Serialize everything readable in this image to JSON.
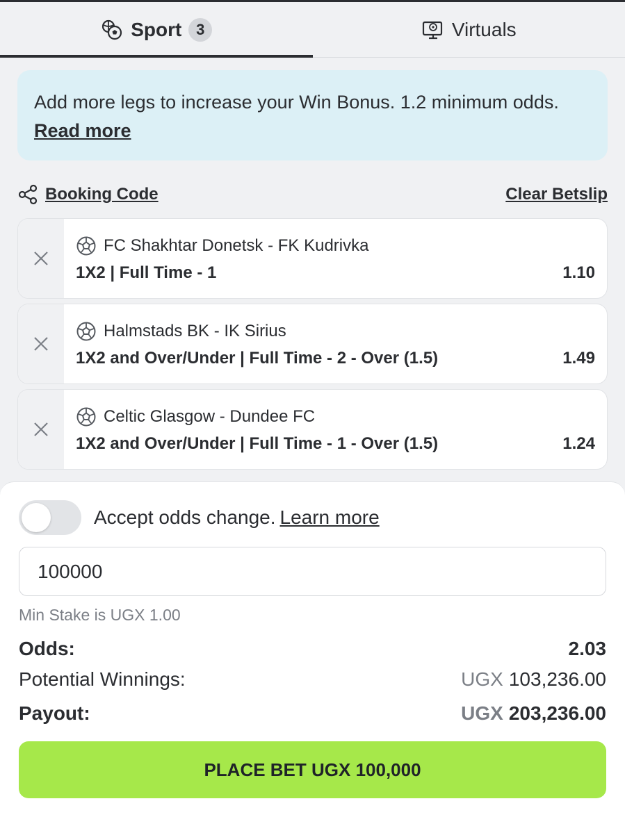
{
  "tabs": [
    {
      "label": "Sport",
      "badge": "3",
      "icon": "sports-balls-icon"
    },
    {
      "label": "Virtuals",
      "icon": "virtual-screen-icon"
    }
  ],
  "info_banner": {
    "text": "Add more legs to increase your Win Bonus. 1.2 minimum odds.",
    "link": "Read more"
  },
  "actions": {
    "booking_code": "Booking Code",
    "clear_betslip": "Clear Betslip"
  },
  "legs": [
    {
      "match": "FC Shakhtar Donetsk - FK Kudrivka",
      "selection": "1X2 | Full Time - 1",
      "odds": "1.10"
    },
    {
      "match": "Halmstads BK - IK Sirius",
      "selection": "1X2 and Over/Under | Full Time - 2 - Over (1.5)",
      "odds": "1.49"
    },
    {
      "match": "Celtic Glasgow - Dundee FC",
      "selection": "1X2 and Over/Under | Full Time - 1 - Over (1.5)",
      "odds": "1.24"
    }
  ],
  "betslip": {
    "accept_odds_text": "Accept odds change.",
    "learn_more": "Learn more",
    "stake_value": "100000",
    "min_stake": "Min Stake is UGX 1.00",
    "odds_label": "Odds:",
    "odds_value": "2.03",
    "potential_label": "Potential Winnings:",
    "potential_currency": "UGX",
    "potential_value": "103,236.00",
    "payout_label": "Payout:",
    "payout_currency": "UGX",
    "payout_value": "203,236.00",
    "place_bet": "PLACE BET UGX 100,000"
  },
  "colors": {
    "accent_green": "#a6e84a",
    "info_bg": "#dcf0f6"
  }
}
